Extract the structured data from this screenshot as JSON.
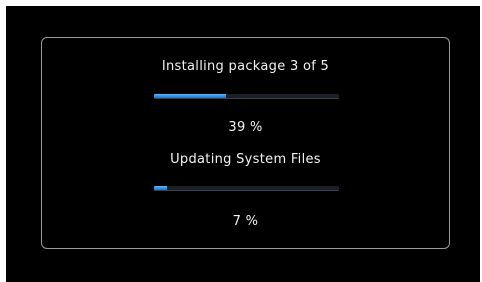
{
  "install": {
    "title": "Installing package 3 of 5",
    "progress_fraction": 0.39,
    "progress_text": "39 %"
  },
  "update": {
    "title": "Updating System Files",
    "progress_fraction": 0.07,
    "progress_text": "7 %"
  },
  "colors": {
    "progress_fill": "#3a95f0",
    "dialog_border": "#9a9a9a",
    "text": "#f2f2f2"
  }
}
